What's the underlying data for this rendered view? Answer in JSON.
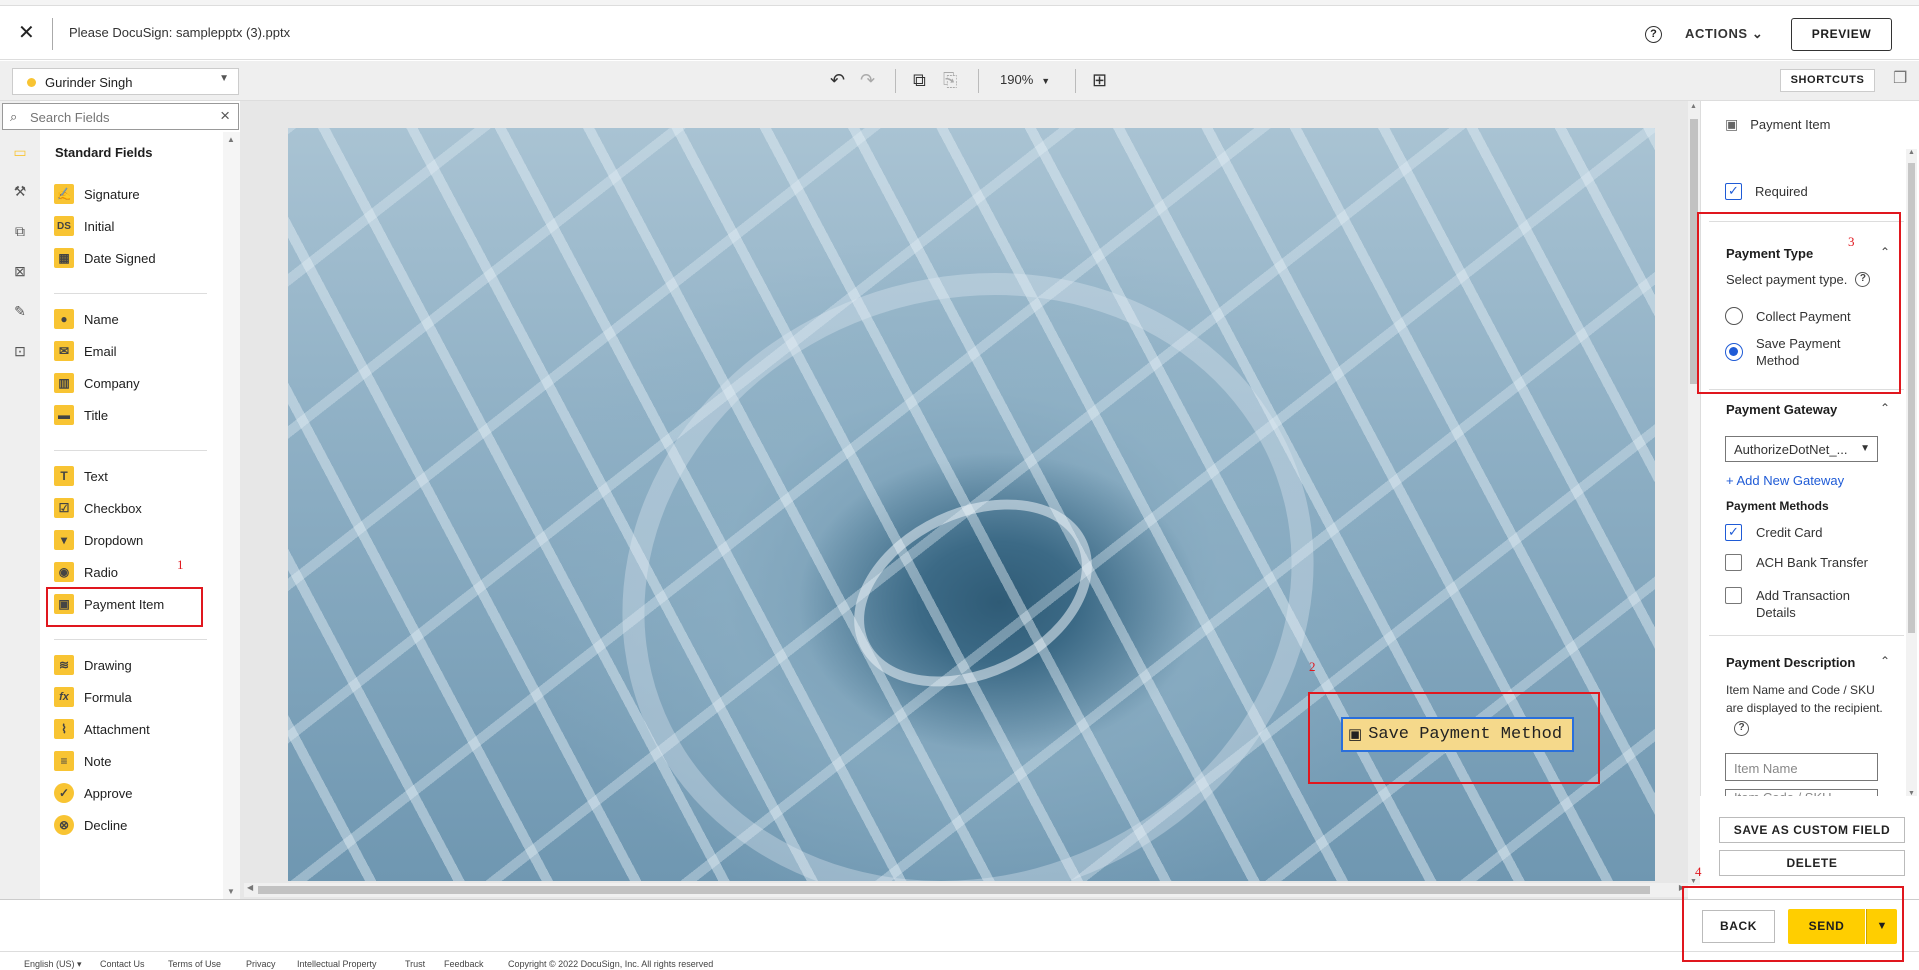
{
  "header": {
    "close_label": "✕",
    "doc_title": "Please DocuSign: samplepptx (3).pptx",
    "help_label": "?",
    "actions_label": "ACTIONS",
    "preview_label": "PREVIEW"
  },
  "toolbar": {
    "recipient_name": "Gurinder Singh",
    "recipient_color": "#f8c433",
    "zoom": "190%",
    "shortcuts_label": "SHORTCUTS"
  },
  "search": {
    "placeholder": "Search Fields"
  },
  "fields_panel": {
    "title": "Standard Fields",
    "group1": [
      {
        "label": "Signature",
        "icon": "signature-icon",
        "glyph": "✍"
      },
      {
        "label": "Initial",
        "icon": "initial-icon",
        "glyph": "DS"
      },
      {
        "label": "Date Signed",
        "icon": "calendar-icon",
        "glyph": "▦"
      }
    ],
    "group2": [
      {
        "label": "Name",
        "icon": "person-icon",
        "glyph": "●"
      },
      {
        "label": "Email",
        "icon": "envelope-icon",
        "glyph": "✉"
      },
      {
        "label": "Company",
        "icon": "building-icon",
        "glyph": "▥"
      },
      {
        "label": "Title",
        "icon": "briefcase-icon",
        "glyph": "▬"
      }
    ],
    "group3": [
      {
        "label": "Text",
        "icon": "text-icon",
        "glyph": "T"
      },
      {
        "label": "Checkbox",
        "icon": "checkbox-icon",
        "glyph": "☑"
      },
      {
        "label": "Dropdown",
        "icon": "dropdown-icon",
        "glyph": "▾"
      },
      {
        "label": "Radio",
        "icon": "radio-icon",
        "glyph": "◉"
      },
      {
        "label": "Payment Item",
        "icon": "payment-icon",
        "glyph": "▣"
      }
    ],
    "group4": [
      {
        "label": "Drawing",
        "icon": "drawing-icon",
        "glyph": "≋"
      },
      {
        "label": "Formula",
        "icon": "formula-icon",
        "glyph": "fx"
      },
      {
        "label": "Attachment",
        "icon": "paperclip-icon",
        "glyph": "⌇"
      },
      {
        "label": "Note",
        "icon": "note-icon",
        "glyph": "≡"
      },
      {
        "label": "Approve",
        "icon": "approve-icon",
        "glyph": "✓"
      },
      {
        "label": "Decline",
        "icon": "decline-icon",
        "glyph": "⊗"
      }
    ]
  },
  "document": {
    "payment_field_label": "Save Payment Method",
    "payment_field_fill": "#f5d98b",
    "selection_color": "#2a6fdb"
  },
  "properties": {
    "title": "Payment Item",
    "required_label": "Required",
    "required_checked": true,
    "payment_type": {
      "title": "Payment Type",
      "instruction": "Select payment type.",
      "options": [
        "Collect Payment",
        "Save Payment Method"
      ],
      "selected": "Save Payment Method"
    },
    "gateway": {
      "title": "Payment Gateway",
      "selected": "AuthorizeDotNet_...",
      "add_link": "+ Add New Gateway"
    },
    "methods": {
      "title": "Payment Methods",
      "items": [
        {
          "label": "Credit Card",
          "checked": true
        },
        {
          "label": "ACH Bank Transfer",
          "checked": false
        },
        {
          "label": "Add Transaction Details",
          "checked": false
        }
      ]
    },
    "description": {
      "title": "Payment Description",
      "text": "Item Name and Code / SKU are displayed to the recipient.",
      "item_name_placeholder": "Item Name",
      "item_code_placeholder": "Item Code / SKU"
    },
    "save_custom_label": "SAVE AS CUSTOM FIELD",
    "delete_label": "DELETE"
  },
  "bottom": {
    "back_label": "BACK",
    "send_label": "SEND",
    "send_color": "#ffce00"
  },
  "footer": {
    "language": "English (US) ▾",
    "links": [
      "Contact Us",
      "Terms of Use",
      "Privacy",
      "Intellectual Property",
      "Trust",
      "Feedback"
    ],
    "copyright": "Copyright © 2022 DocuSign, Inc. All rights reserved"
  },
  "annotations": {
    "n1": "1",
    "n2": "2",
    "n3": "3",
    "n4": "4",
    "color": "#e0171e"
  }
}
